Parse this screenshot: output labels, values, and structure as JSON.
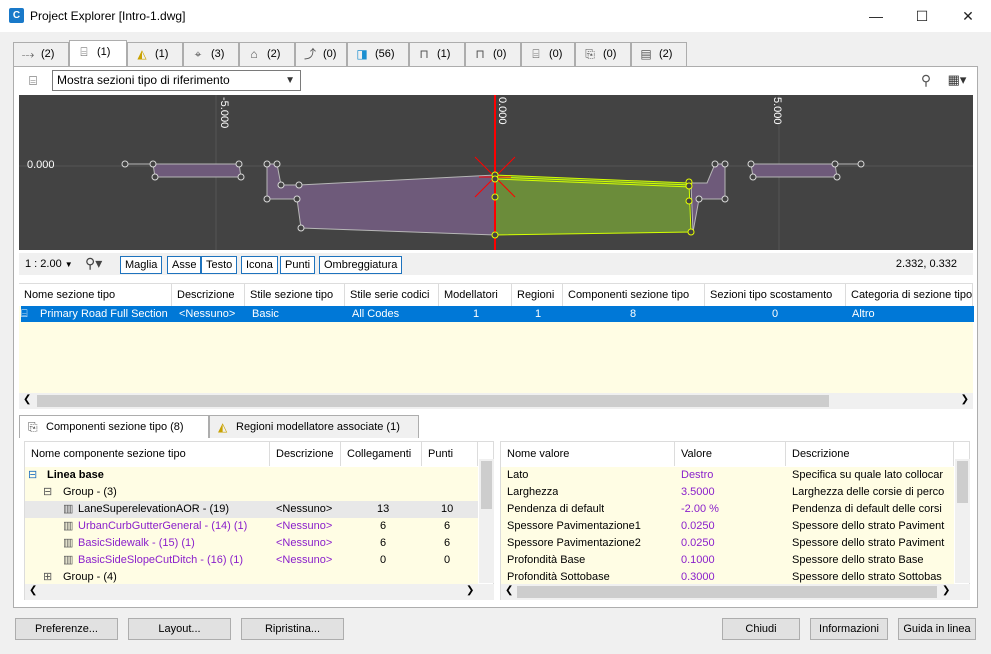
{
  "window": {
    "title": "Project Explorer [Intro-1.dwg]",
    "minimize": "—",
    "maximize": "☐",
    "close": "✕"
  },
  "tabs": [
    {
      "count": "(2)",
      "icon": "alignment-icon"
    },
    {
      "count": "(1)",
      "icon": "assembly-icon"
    },
    {
      "count": "(1)",
      "icon": "corridor-icon"
    },
    {
      "count": "(3)",
      "icon": "profile-icon"
    },
    {
      "count": "(2)",
      "icon": "surface-icon"
    },
    {
      "count": "(0)",
      "icon": "feature-line-icon"
    },
    {
      "count": "(56)",
      "icon": "subassembly-icon"
    },
    {
      "count": "(1)",
      "icon": "pipe-network-icon"
    },
    {
      "count": "(0)",
      "icon": "pressure-network-icon"
    },
    {
      "count": "(0)",
      "icon": "section-view-icon"
    },
    {
      "count": "(0)",
      "icon": "sample-line-icon"
    },
    {
      "count": "(2)",
      "icon": "drawing-icon"
    }
  ],
  "toolbar": {
    "dropdown_value": "Mostra sezioni tipo di riferimento"
  },
  "viewer": {
    "labels": {
      "x_neg": "-5.000",
      "x_zero": "0.000",
      "x_pos": "5.000",
      "y_zero": "0.000"
    },
    "scale": "1 : 2.00",
    "coords": "2.332, 0.332",
    "buttons": [
      "Maglia",
      "Asse",
      "Testo",
      "Icona",
      "Punti",
      "Ombreggiatura"
    ]
  },
  "grid1": {
    "headers": [
      "Nome sezione tipo",
      "Descrizione",
      "Stile sezione tipo",
      "Stile serie codici",
      "Modellatori",
      "Regioni",
      "Componenti sezione tipo",
      "Sezioni tipo scostamento",
      "Categoria di sezione tipo"
    ],
    "row": [
      "Primary Road Full Section",
      "<Nessuno>",
      "Basic",
      "All Codes",
      "1",
      "1",
      "8",
      "0",
      "Altro"
    ]
  },
  "bottom_tabs": [
    "Componenti sezione tipo (8)",
    "Regioni modellatore associate (1)"
  ],
  "left_grid": {
    "headers": [
      "Nome componente sezione tipo",
      "Descrizione",
      "Collegamenti",
      "Punti"
    ],
    "rows": [
      {
        "name": "Linea base",
        "desc": "",
        "links": "",
        "points": ""
      },
      {
        "name": "Group - (3)",
        "desc": "",
        "links": "",
        "points": ""
      },
      {
        "name": "LaneSuperelevationAOR - (19)",
        "desc": "<Nessuno>",
        "links": "13",
        "points": "10"
      },
      {
        "name": "UrbanCurbGutterGeneral - (14) (1)",
        "desc": "<Nessuno>",
        "links": "6",
        "points": "6"
      },
      {
        "name": "BasicSidewalk - (15) (1)",
        "desc": "<Nessuno>",
        "links": "6",
        "points": "6"
      },
      {
        "name": "BasicSideSlopeCutDitch - (16) (1)",
        "desc": "<Nessuno>",
        "links": "0",
        "points": "0"
      },
      {
        "name": "Group - (4)",
        "desc": "",
        "links": "",
        "points": ""
      }
    ]
  },
  "right_grid": {
    "headers": [
      "Nome valore",
      "Valore",
      "Descrizione"
    ],
    "rows": [
      {
        "name": "Lato",
        "value": "Destro",
        "desc": "Specifica su quale lato collocar"
      },
      {
        "name": "Larghezza",
        "value": "3.5000",
        "desc": "Larghezza delle corsie di perco"
      },
      {
        "name": "Pendenza di default",
        "value": "-2.00 %",
        "desc": "Pendenza di default delle corsi"
      },
      {
        "name": "Spessore Pavimentazione1",
        "value": "0.0250",
        "desc": "Spessore dello strato Paviment"
      },
      {
        "name": "Spessore Pavimentazione2",
        "value": "0.0250",
        "desc": "Spessore dello strato Paviment"
      },
      {
        "name": "Profondità Base",
        "value": "0.1000",
        "desc": "Spessore dello strato Base"
      },
      {
        "name": "Profondità Sottobase",
        "value": "0.3000",
        "desc": "Spessore dello strato Sottobas"
      }
    ]
  },
  "buttons": {
    "preferences": "Preferenze...",
    "layout": "Layout...",
    "restore": "Ripristina...",
    "close": "Chiudi",
    "info": "Informazioni",
    "help": "Guida in linea"
  }
}
